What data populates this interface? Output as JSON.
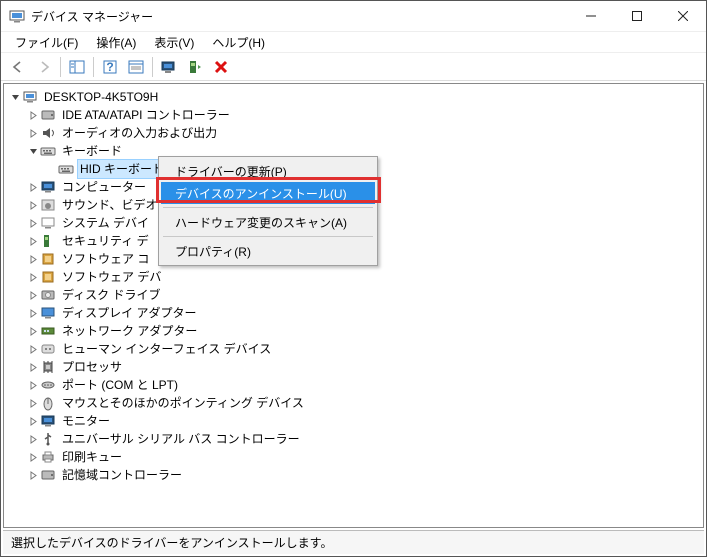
{
  "window": {
    "title": "デバイス マネージャー"
  },
  "menu": {
    "file": "ファイル(F)",
    "action": "操作(A)",
    "view": "表示(V)",
    "help": "ヘルプ(H)"
  },
  "root": {
    "label": "DESKTOP-4K5TO9H"
  },
  "categories": [
    {
      "id": "ide",
      "label": "IDE ATA/ATAPI コントローラー",
      "expanded": false
    },
    {
      "id": "audio",
      "label": "オーディオの入力および出力",
      "expanded": false
    },
    {
      "id": "keyboard",
      "label": "キーボード",
      "expanded": true,
      "children": [
        {
          "id": "hidkbd",
          "label": "HID キーボード デバイス",
          "selected": true
        }
      ]
    },
    {
      "id": "computer",
      "label": "コンピューター",
      "expanded": false
    },
    {
      "id": "sound",
      "label": "サウンド、ビデオ",
      "expanded": false,
      "truncated": true
    },
    {
      "id": "sysdev",
      "label": "システム デバイ",
      "expanded": false,
      "truncated": true
    },
    {
      "id": "security",
      "label": "セキュリティ デ",
      "expanded": false,
      "truncated": true
    },
    {
      "id": "swcomp",
      "label": "ソフトウェア コ",
      "expanded": false,
      "truncated": true
    },
    {
      "id": "swdev",
      "label": "ソフトウェア デバ",
      "expanded": false,
      "truncated": true
    },
    {
      "id": "disk",
      "label": "ディスク ドライブ",
      "expanded": false
    },
    {
      "id": "display",
      "label": "ディスプレイ アダプター",
      "expanded": false
    },
    {
      "id": "network",
      "label": "ネットワーク アダプター",
      "expanded": false
    },
    {
      "id": "hid",
      "label": "ヒューマン インターフェイス デバイス",
      "expanded": false
    },
    {
      "id": "cpu",
      "label": "プロセッサ",
      "expanded": false
    },
    {
      "id": "ports",
      "label": "ポート (COM と LPT)",
      "expanded": false
    },
    {
      "id": "mouse",
      "label": "マウスとそのほかのポインティング デバイス",
      "expanded": false
    },
    {
      "id": "monitor",
      "label": "モニター",
      "expanded": false
    },
    {
      "id": "usb",
      "label": "ユニバーサル シリアル バス コントローラー",
      "expanded": false
    },
    {
      "id": "print",
      "label": "印刷キュー",
      "expanded": false
    },
    {
      "id": "storage",
      "label": "記憶域コントローラー",
      "expanded": false
    }
  ],
  "context_menu": {
    "update": "ドライバーの更新(P)",
    "uninstall": "デバイスのアンインストール(U)",
    "scan": "ハードウェア変更のスキャン(A)",
    "properties": "プロパティ(R)"
  },
  "status": "選択したデバイスのドライバーをアンインストールします。"
}
